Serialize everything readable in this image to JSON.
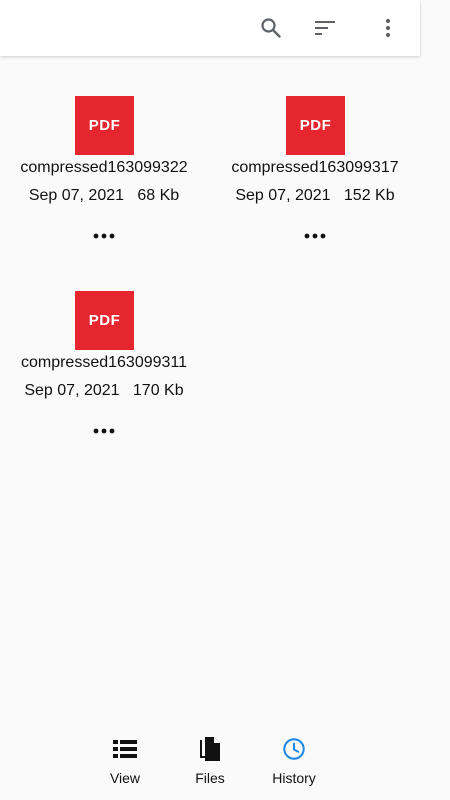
{
  "toolbar": {
    "icons": [
      "search-icon",
      "sort-icon",
      "more-vert-icon"
    ]
  },
  "files": [
    {
      "icon_label": "PDF",
      "name": "compressed163099322",
      "date": "Sep 07, 2021",
      "size": "68 Kb"
    },
    {
      "icon_label": "PDF",
      "name": "compressed163099317",
      "date": "Sep 07, 2021",
      "size": "152 Kb"
    },
    {
      "icon_label": "PDF",
      "name": "compressed163099311",
      "date": "Sep 07, 2021",
      "size": "170 Kb"
    }
  ],
  "bottom_nav": {
    "items": [
      {
        "label": "View",
        "icon": "list-view-icon"
      },
      {
        "label": "Files",
        "icon": "files-icon"
      },
      {
        "label": "History",
        "icon": "history-clock-icon",
        "active": true
      }
    ],
    "active_color": "#1e88e5"
  },
  "colors": {
    "pdf_red": "#e5262e",
    "toolbar_icon": "#5f6368"
  }
}
